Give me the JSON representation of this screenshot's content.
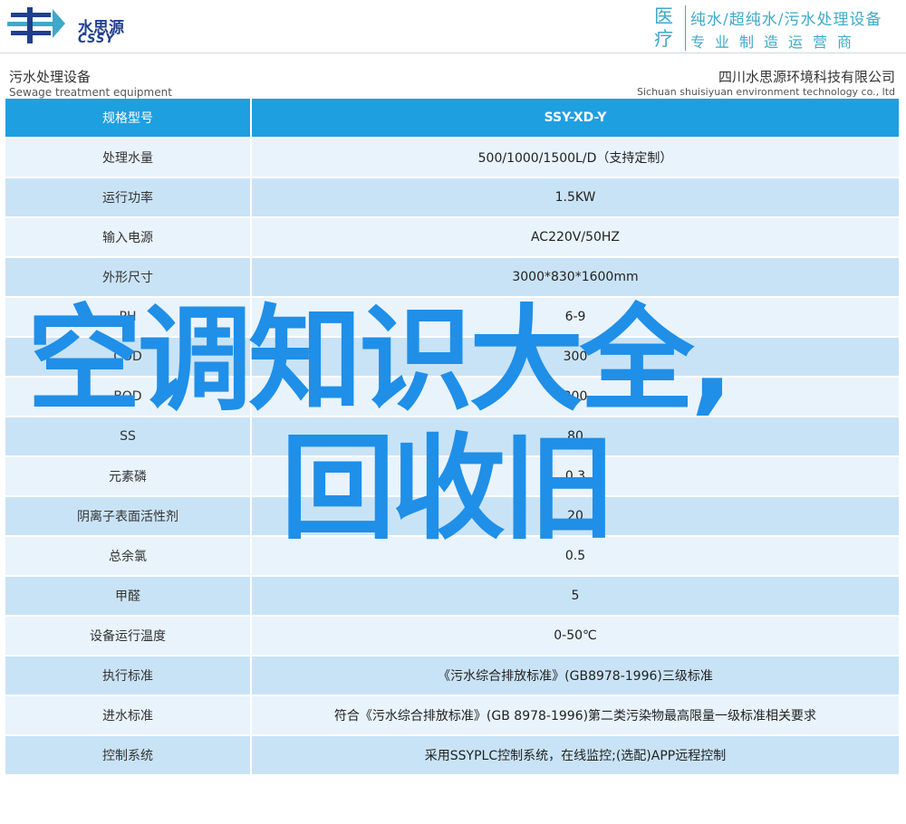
{
  "header": {
    "logo_cn": "水思源",
    "logo_en": "CSSY",
    "tag_mark": "医疗",
    "tag_line1": "纯水/超纯水/污水处理设备",
    "tag_line2": "专业制造运营商"
  },
  "subheader": {
    "left_cn": "污水处理设备",
    "left_en": "Sewage treatment equipment",
    "right_cn": "四川水思源环境科技有限公司",
    "right_en": "Sichuan shuisiyuan environment technology co., ltd"
  },
  "table": {
    "rows": [
      {
        "label": "规格型号",
        "value": "SSY-XD-Y"
      },
      {
        "label": "处理水量",
        "value": "500/1000/1500L/D（支持定制）"
      },
      {
        "label": "运行功率",
        "value": "1.5KW"
      },
      {
        "label": "输入电源",
        "value": "AC220V/50HZ"
      },
      {
        "label": "外形尺寸",
        "value": "3000*830*1600mm"
      },
      {
        "label": "PH",
        "value": "6-9"
      },
      {
        "label": "COD",
        "value": "300"
      },
      {
        "label": "BOD",
        "value": "300"
      },
      {
        "label": "SS",
        "value": "80"
      },
      {
        "label": "元素磷",
        "value": "0.3"
      },
      {
        "label": "阴离子表面活性剂",
        "value": "20"
      },
      {
        "label": "总余氯",
        "value": "0.5"
      },
      {
        "label": "甲醛",
        "value": "5"
      },
      {
        "label": "设备运行温度",
        "value": "0-50℃"
      },
      {
        "label": "执行标准",
        "value": "《污水综合排放标准》(GB8978-1996)三级标准"
      },
      {
        "label": "进水标准",
        "value": "符合《污水综合排放标准》(GB 8978-1996)第二类污染物最高限量一级标准相关要求"
      },
      {
        "label": "控制系统",
        "value": "采用SSYPLC控制系统，在线监控;(选配)APP远程控制"
      }
    ]
  },
  "overlay": {
    "line1": "空调知识大全,",
    "line2": "回收旧"
  },
  "colors": {
    "header_row": "#1e9fe0",
    "row_light": "#e9f3fb",
    "row_dark": "#c9e3f6",
    "overlay_text": "#1f8fe8",
    "brand": "#1f3f8f",
    "tagline": "#3fa9c9"
  }
}
